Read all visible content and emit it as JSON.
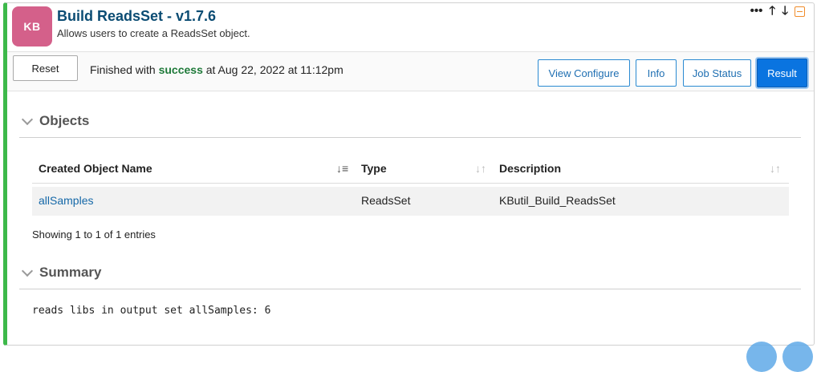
{
  "app": {
    "icon_text": "KB",
    "title": "Build ReadsSet - v1.7.6",
    "description": "Allows users to create a ReadsSet object."
  },
  "header_controls": {
    "more": "•••",
    "up": "🡑",
    "down": "🡓"
  },
  "toolbar": {
    "reset_label": "Reset",
    "status_prefix": "Finished with",
    "status_word": "success",
    "status_suffix": "at Aug 22, 2022 at 11:12pm",
    "view_configure_label": "View Configure",
    "info_label": "Info",
    "job_status_label": "Job Status",
    "result_label": "Result"
  },
  "objects": {
    "title": "Objects",
    "columns": [
      "Created Object Name",
      "Type",
      "Description"
    ],
    "rows": [
      {
        "name": "allSamples",
        "type": "ReadsSet",
        "description": "KButil_Build_ReadsSet"
      }
    ],
    "entries_text": "Showing 1 to 1 of 1 entries"
  },
  "summary": {
    "title": "Summary",
    "text": "reads libs in output set allSamples: 6"
  },
  "colors": {
    "accent_green": "#3db94a",
    "icon_bg": "#d4608a",
    "primary_blue": "#0a74e0"
  }
}
